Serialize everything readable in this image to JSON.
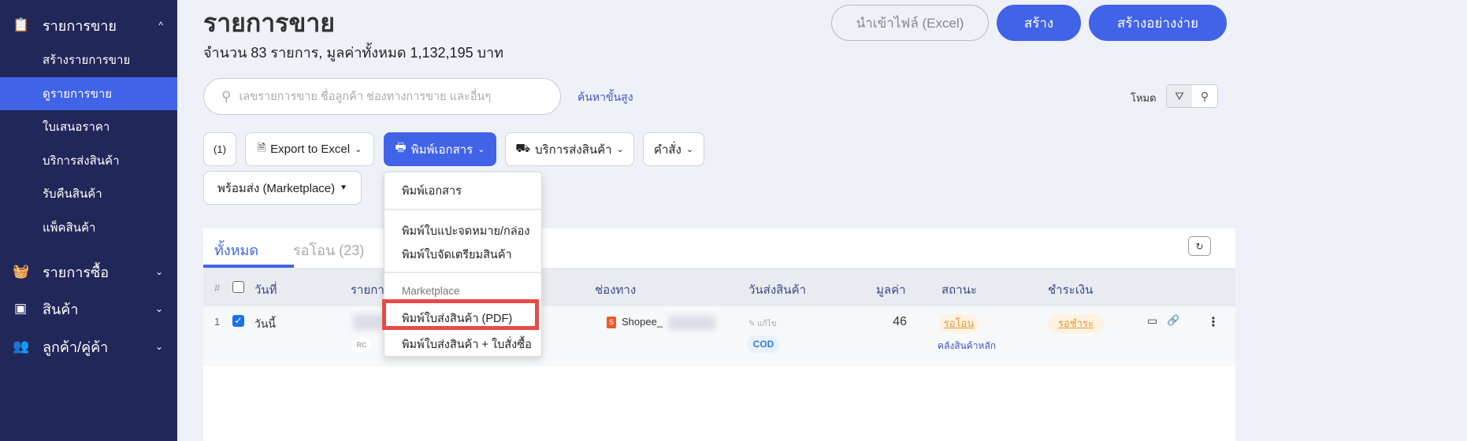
{
  "sidebar": {
    "sales": {
      "label": "รายการขาย",
      "icon": "clipboard-icon"
    },
    "sub": [
      "สร้างรายการขาย",
      "ดูรายการขาย",
      "ใบเสนอราคา",
      "บริการส่งสินค้า",
      "รับคืนสินค้า",
      "แพ็คสินค้า"
    ],
    "purchases": {
      "label": "รายการซื้อ",
      "icon": "basket-icon"
    },
    "products": {
      "label": "สินค้า",
      "icon": "box-icon"
    },
    "contacts": {
      "label": "ลูกค้า/คู่ค้า",
      "icon": "users-icon"
    }
  },
  "header": {
    "title": "รายการขาย",
    "summary": "จำนวน 83 รายการ, มูลค่าทั้งหมด 1,132,195 บาท",
    "import_label": "นำเข้าไฟล์ (Excel)",
    "create_label": "สร้าง",
    "quick_create_label": "สร้างอย่างง่าย"
  },
  "search": {
    "placeholder": "เลขรายการขาย ชื่อลูกค้า ช่องทางการขาย และอื่นๆ",
    "advanced": "ค้นหาขั้นสูง",
    "mode_label": "โหมด"
  },
  "toolbar": {
    "selected": "(1)",
    "export": "Export to Excel",
    "print": "พิมพ์เอกสาร",
    "shipping": "บริการส่งสินค้า",
    "commands": "คำสั่ง",
    "ready": "พร้อมส่ง (Marketplace)"
  },
  "print_menu": {
    "items": [
      "พิมพ์เอกสาร",
      "พิมพ์ใบแปะจดหมาย/กล่อง",
      "พิมพ์ใบจัดเตรียมสินค้า"
    ],
    "section": "Marketplace",
    "marketplace_items": [
      "พิมพ์ใบส่งสินค้า (PDF)",
      "พิมพ์ใบส่งสินค้า + ใบสั่งซื้อ"
    ],
    "highlight_color": "#e84a45"
  },
  "tabs": [
    {
      "label": "ทั้งหมด",
      "active": true
    },
    {
      "label": "รอโอน (23)",
      "active": false
    }
  ],
  "table": {
    "columns": [
      "#",
      "วันที่",
      "รายการ",
      "ช่องทาง",
      "วันส่งสินค้า",
      "มูลค่า",
      "สถานะ",
      "ชำระเงิน"
    ],
    "rows": [
      {
        "index": "1",
        "checked": true,
        "date": "วันนี้",
        "tag": "RC",
        "channel": "Shopee_",
        "edit": "แก้ไข",
        "payment_type": "COD",
        "value": "46",
        "status": "รอโอน",
        "warehouse": "คลังสินค้าหลัก",
        "payment": "รอชำระ"
      }
    ]
  },
  "colors": {
    "sidebar": "#22275a",
    "accent": "#4163e8",
    "status_warn": "#f0a040"
  }
}
